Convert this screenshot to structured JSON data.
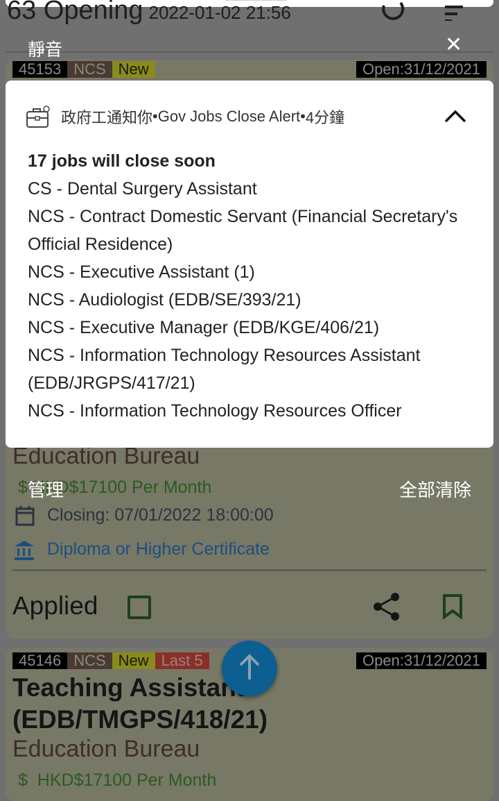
{
  "header": {
    "title": "63 Opening",
    "timestamp": "2022-01-02 21:56"
  },
  "shade": {
    "silent_label": "靜音",
    "manage_label": "管理",
    "clear_all_label": "全部清除"
  },
  "notification": {
    "app_name": "政府工通知你",
    "channel": "Gov Jobs Close Alert",
    "time": "4分鐘",
    "title": "17 jobs will close soon",
    "lines": [
      "CS - Dental Surgery Assistant",
      "NCS - Contract Domestic Servant (Financial Secretary's Official Residence)",
      "NCS - Executive Assistant (1)",
      "NCS - Audiologist (EDB/SE/393/21)",
      "NCS - Executive Manager (EDB/KGE/406/21)",
      "NCS - Information Technology Resources Assistant (EDB/JRGPS/417/21)",
      "NCS - Information Technology Resources Officer"
    ]
  },
  "jobs": [
    {
      "id": "45153",
      "type": "NCS",
      "new": "New",
      "open": "Open:31/12/2021",
      "org": "Education Bureau",
      "salary": "HKD$17100  Per Month",
      "closing": "Closing: 07/01/2022 18:00:00",
      "qualification": "Diploma or Higher Certificate",
      "applied_label": "Applied"
    },
    {
      "id": "45146",
      "type": "NCS",
      "new": "New",
      "last": "Last 5",
      "open": "Open:31/12/2021",
      "title": "Teaching Assistant (EDB/TMGPS/418/21)",
      "org": "Education Bureau",
      "salary": "HKD$17100  Per Month"
    }
  ],
  "colors": {
    "fab": "#0c5f90",
    "scrim": "#707070"
  }
}
